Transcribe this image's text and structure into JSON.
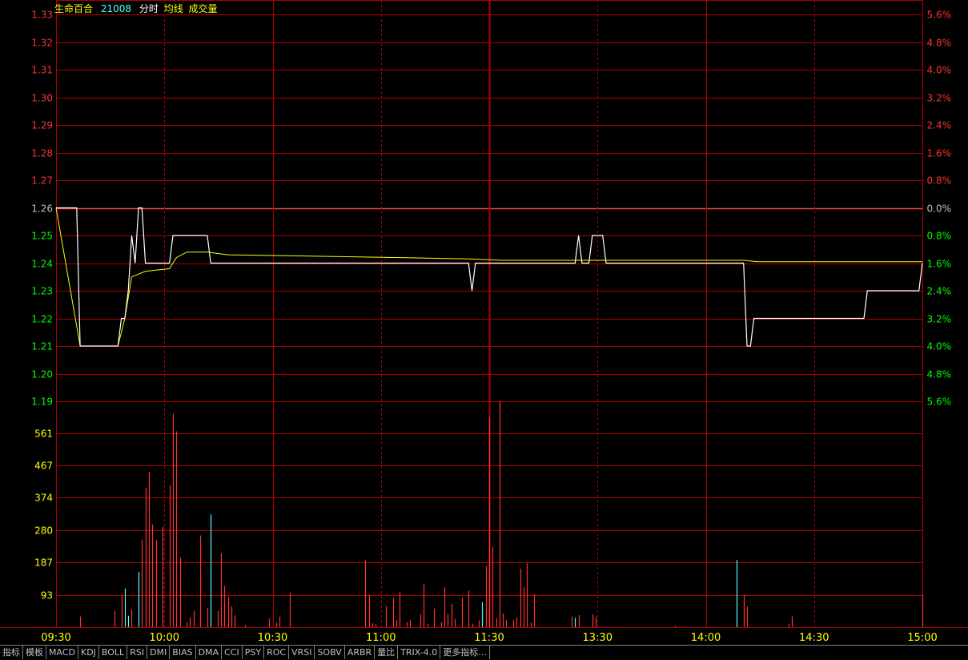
{
  "header": {
    "name": "生命百合",
    "code": "21008",
    "mode": "分时",
    "avg_label": "均线",
    "vol_label": "成交量"
  },
  "colors": {
    "up": "#ff3232",
    "down": "#54fcfc",
    "price_line": "#ffffff",
    "avg_line": "#ffff00",
    "grid": "#b00000",
    "gain": "#ff3232",
    "loss": "#00ff00",
    "neutral": "#c0c0c0",
    "vol_tick": "#ffff00",
    "time_tick": "#ffff00"
  },
  "chart_data": [
    {
      "type": "line",
      "title": "",
      "prev_close": 1.26,
      "ylim": [
        1.19,
        1.33
      ],
      "yticks_left": [
        "1.33",
        "1.32",
        "1.31",
        "1.30",
        "1.29",
        "1.28",
        "1.27",
        "1.26",
        "1.25",
        "1.24",
        "1.23",
        "1.22",
        "1.21",
        "1.20",
        "1.19"
      ],
      "yticks_right": [
        "5.6%",
        "4.8%",
        "4.0%",
        "3.2%",
        "2.4%",
        "1.6%",
        "0.8%",
        "0.0%",
        "0.8%",
        "1.6%",
        "2.4%",
        "3.2%",
        "4.0%",
        "4.8%",
        "5.6%"
      ],
      "x_ticks": [
        "09:30",
        "10:00",
        "10:30",
        "11:00",
        "11:30",
        "13:30",
        "14:00",
        "14:30",
        "15:00"
      ],
      "series": [
        {
          "points": [
            [
              0,
              1.26
            ],
            [
              6,
              1.26
            ],
            [
              7,
              1.21
            ],
            [
              18,
              1.21
            ],
            [
              19,
              1.22
            ],
            [
              20,
              1.22
            ],
            [
              21,
              1.23
            ],
            [
              22,
              1.25
            ],
            [
              23,
              1.24
            ],
            [
              24,
              1.26
            ],
            [
              25,
              1.26
            ],
            [
              26,
              1.24
            ],
            [
              33,
              1.24
            ],
            [
              34,
              1.25
            ],
            [
              44,
              1.25
            ],
            [
              45,
              1.24
            ],
            [
              120,
              1.24
            ],
            [
              121,
              1.23
            ],
            [
              122,
              1.24
            ],
            [
              151,
              1.24
            ],
            [
              152,
              1.25
            ],
            [
              153,
              1.24
            ],
            [
              155,
              1.24
            ],
            [
              156,
              1.25
            ],
            [
              159,
              1.25
            ],
            [
              160,
              1.24
            ],
            [
              200,
              1.24
            ],
            [
              201,
              1.21
            ],
            [
              202,
              1.21
            ],
            [
              203,
              1.22
            ],
            [
              235,
              1.22
            ],
            [
              236,
              1.23
            ],
            [
              251,
              1.23
            ],
            [
              252,
              1.24
            ]
          ]
        },
        {
          "points": [
            [
              0,
              1.26
            ],
            [
              7,
              1.21
            ],
            [
              18,
              1.21
            ],
            [
              20,
              1.22
            ],
            [
              22,
              1.235
            ],
            [
              26,
              1.237
            ],
            [
              33,
              1.238
            ],
            [
              35,
              1.242
            ],
            [
              38,
              1.244
            ],
            [
              44,
              1.244
            ],
            [
              50,
              1.243
            ],
            [
              100,
              1.242
            ],
            [
              120,
              1.2415
            ],
            [
              130,
              1.241
            ],
            [
              150,
              1.241
            ],
            [
              200,
              1.241
            ],
            [
              204,
              1.2405
            ],
            [
              252,
              1.2405
            ]
          ]
        }
      ]
    },
    {
      "type": "bar",
      "title": "",
      "ylim": [
        0,
        654
      ],
      "yticks": [
        "561",
        "467",
        "374",
        "280",
        "187",
        "93"
      ],
      "bars": [
        [
          7,
          31,
          "up"
        ],
        [
          17,
          46,
          "up"
        ],
        [
          19,
          93,
          "up"
        ],
        [
          20,
          112,
          "down"
        ],
        [
          21,
          33,
          "down"
        ],
        [
          22,
          50,
          "up"
        ],
        [
          24,
          159,
          "down"
        ],
        [
          25,
          253,
          "up"
        ],
        [
          26,
          402,
          "up"
        ],
        [
          27,
          449,
          "up"
        ],
        [
          28,
          297,
          "up"
        ],
        [
          29,
          252,
          "up"
        ],
        [
          31,
          290,
          "up"
        ],
        [
          33,
          411,
          "up"
        ],
        [
          34,
          617,
          "up"
        ],
        [
          35,
          566,
          "up"
        ],
        [
          36,
          201,
          "up"
        ],
        [
          38,
          13,
          "up"
        ],
        [
          39,
          28,
          "up"
        ],
        [
          40,
          47,
          "up"
        ],
        [
          42,
          265,
          "up"
        ],
        [
          44,
          55,
          "up"
        ],
        [
          45,
          326,
          "down"
        ],
        [
          47,
          46,
          "up"
        ],
        [
          48,
          214,
          "up"
        ],
        [
          49,
          119,
          "up"
        ],
        [
          50,
          87,
          "up"
        ],
        [
          51,
          60,
          "up"
        ],
        [
          52,
          34,
          "up"
        ],
        [
          55,
          7,
          "up"
        ],
        [
          62,
          25,
          "up"
        ],
        [
          64,
          13,
          "up"
        ],
        [
          65,
          31,
          "up"
        ],
        [
          68,
          100,
          "up"
        ],
        [
          90,
          193,
          "up"
        ],
        [
          91,
          94,
          "up"
        ],
        [
          92,
          12,
          "up"
        ],
        [
          93,
          9,
          "up"
        ],
        [
          96,
          61,
          "up"
        ],
        [
          98,
          85,
          "up"
        ],
        [
          99,
          21,
          "up"
        ],
        [
          100,
          101,
          "up"
        ],
        [
          102,
          14,
          "up"
        ],
        [
          103,
          20,
          "up"
        ],
        [
          106,
          38,
          "up"
        ],
        [
          107,
          126,
          "up"
        ],
        [
          108,
          10,
          "up"
        ],
        [
          110,
          54,
          "up"
        ],
        [
          112,
          14,
          "up"
        ],
        [
          113,
          115,
          "up"
        ],
        [
          114,
          38,
          "up"
        ],
        [
          115,
          68,
          "up"
        ],
        [
          116,
          24,
          "up"
        ],
        [
          118,
          85,
          "up"
        ],
        [
          120,
          105,
          "up"
        ],
        [
          121,
          10,
          "up"
        ],
        [
          123,
          20,
          "up"
        ],
        [
          124,
          72,
          "down"
        ],
        [
          125,
          176,
          "up"
        ],
        [
          126,
          608,
          "up"
        ],
        [
          127,
          232,
          "up"
        ],
        [
          128,
          26,
          "up"
        ],
        [
          129,
          654,
          "up"
        ],
        [
          130,
          40,
          "up"
        ],
        [
          131,
          20,
          "up"
        ],
        [
          133,
          21,
          "up"
        ],
        [
          134,
          28,
          "up"
        ],
        [
          135,
          169,
          "up"
        ],
        [
          136,
          115,
          "up"
        ],
        [
          137,
          185,
          "up"
        ],
        [
          138,
          13,
          "up"
        ],
        [
          139,
          96,
          "up"
        ],
        [
          150,
          31,
          "up"
        ],
        [
          151,
          27,
          "down"
        ],
        [
          152,
          35,
          "up"
        ],
        [
          156,
          37,
          "up"
        ],
        [
          157,
          30,
          "up"
        ],
        [
          180,
          4,
          "up"
        ],
        [
          198,
          194,
          "down"
        ],
        [
          200,
          93,
          "up"
        ],
        [
          201,
          60,
          "up"
        ],
        [
          213,
          9,
          "up"
        ],
        [
          214,
          31,
          "up"
        ],
        [
          252,
          93,
          "up"
        ]
      ]
    }
  ],
  "tabs": [
    "指标",
    "模板",
    "MACD",
    "KDJ",
    "BOLL",
    "RSI",
    "DMI",
    "BIAS",
    "DMA",
    "CCI",
    "PSY",
    "ROC",
    "VRSI",
    "SOBV",
    "ARBR",
    "量比",
    "TRIX-4.0",
    "更多指标..."
  ]
}
